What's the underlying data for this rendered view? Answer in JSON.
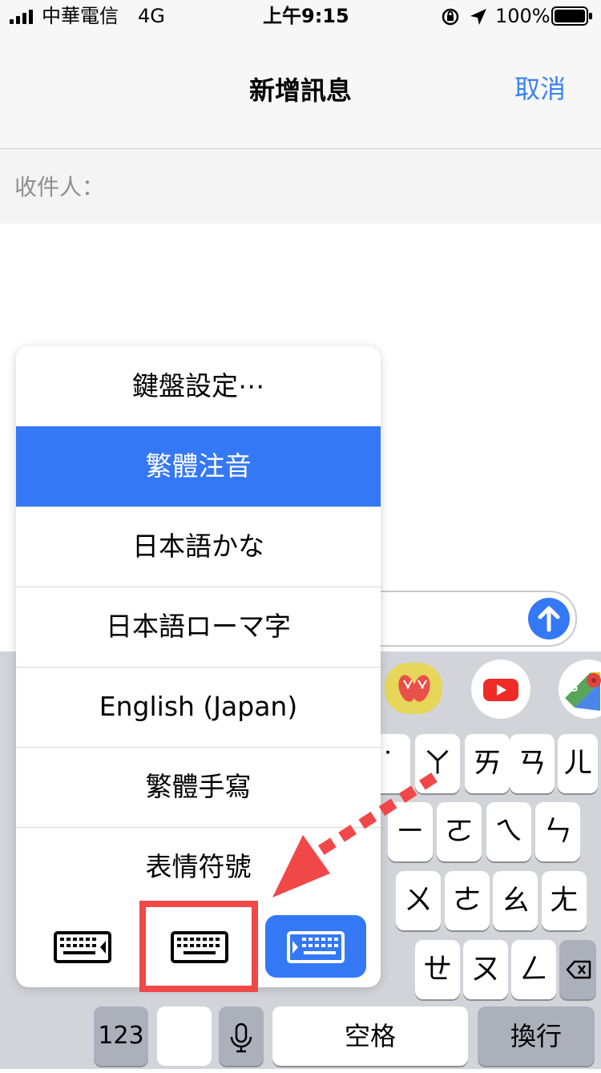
{
  "status_bar": {
    "carrier": "中華電信",
    "network": "4G",
    "time": "上午9:15",
    "battery": "100%"
  },
  "nav": {
    "title": "新增訊息",
    "cancel": "取消"
  },
  "recipient": {
    "label": "收件人："
  },
  "keyboard_menu": {
    "items": [
      {
        "label": "鍵盤設定⋯",
        "selected": false
      },
      {
        "label": "繁體注音",
        "selected": true
      },
      {
        "label": "日本語かな",
        "selected": false
      },
      {
        "label": "日本語ローマ字",
        "selected": false
      },
      {
        "label": "English (Japan)",
        "selected": false
      },
      {
        "label": "繁體手寫",
        "selected": false
      },
      {
        "label": "表情符號",
        "selected": false
      }
    ],
    "layout_buttons": [
      "keyboard-left-icon",
      "keyboard-full-icon",
      "keyboard-right-icon"
    ]
  },
  "keyboard": {
    "row1": [
      "˙",
      "ㄚ",
      "ㄞ",
      "ㄢ",
      "ㄦ"
    ],
    "row2": [
      "ㄧ",
      "ㄛ",
      "ㄟ",
      "ㄣ"
    ],
    "row3": [
      "ㄨ",
      "ㄜ",
      "ㄠ",
      "ㄤ"
    ],
    "row4": [
      "ㄝ",
      "ㄡ",
      "ㄥ"
    ],
    "num_key": "123",
    "space": "空格",
    "return": "換行",
    "apps": [
      "slippers-sticker-icon",
      "youtube-icon",
      "google-maps-icon"
    ]
  },
  "colors": {
    "accent": "#3478f6",
    "annotation": "#f04848"
  }
}
